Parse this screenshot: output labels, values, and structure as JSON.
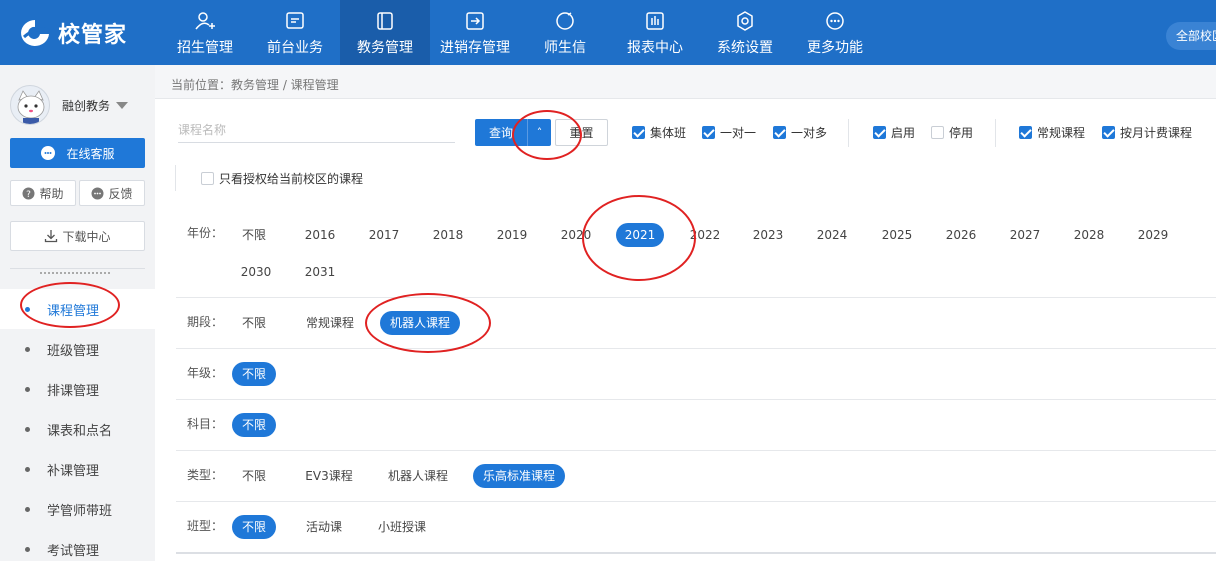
{
  "header": {
    "logo_text": "校管家",
    "nav": [
      {
        "label": "招生管理",
        "icon": "person-add-icon",
        "active": false
      },
      {
        "label": "前台业务",
        "icon": "monitor-icon",
        "active": false
      },
      {
        "label": "教务管理",
        "icon": "book-icon",
        "active": true
      },
      {
        "label": "进销存管理",
        "icon": "inventory-icon",
        "active": false
      },
      {
        "label": "师生信",
        "icon": "chat-icon",
        "active": false
      },
      {
        "label": "报表中心",
        "icon": "chart-icon",
        "active": false
      },
      {
        "label": "系统设置",
        "icon": "gear-icon",
        "active": false
      },
      {
        "label": "更多功能",
        "icon": "more-icon",
        "active": false
      }
    ],
    "campus_label": "全部校区",
    "colors": {
      "primary": "#1f6fc7",
      "active_nav": "#1a5daa",
      "accent": "#1f78d8",
      "annotation": "#e02222"
    }
  },
  "sidebar": {
    "username": "融创教务",
    "online_service": "在线客服",
    "help": "帮助",
    "feedback": "反馈",
    "download": "下载中心",
    "menu": [
      {
        "label": "课程管理",
        "active": true
      },
      {
        "label": "班级管理",
        "active": false
      },
      {
        "label": "排课管理",
        "active": false
      },
      {
        "label": "课表和点名",
        "active": false
      },
      {
        "label": "补课管理",
        "active": false
      },
      {
        "label": "学管师带班",
        "active": false
      },
      {
        "label": "考试管理",
        "active": false
      }
    ]
  },
  "main": {
    "breadcrumb": "当前位置：教务管理 / 课程管理",
    "search_placeholder": "课程名称",
    "query_button": "查询",
    "reset_button": "重置",
    "checkboxes": [
      {
        "label": "集体班",
        "checked": true
      },
      {
        "label": "一对一",
        "checked": true
      },
      {
        "label": "一对多",
        "checked": true
      },
      {
        "label": "启用",
        "checked": true
      },
      {
        "label": "停用",
        "checked": false
      },
      {
        "label": "常规课程",
        "checked": true
      },
      {
        "label": "按月计费课程",
        "checked": true
      }
    ],
    "only_authorized": "只看授权给当前校区的课程",
    "filters": {
      "year": {
        "label": "年份：",
        "options": [
          "不限",
          "2016",
          "2017",
          "2018",
          "2019",
          "2020",
          "2021",
          "2022",
          "2023",
          "2024",
          "2025",
          "2026",
          "2027",
          "2028",
          "2029",
          "2030",
          "2031"
        ],
        "selected": "2021"
      },
      "term": {
        "label": "期段：",
        "options": [
          "不限",
          "常规课程",
          "机器人课程"
        ],
        "selected": "机器人课程"
      },
      "grade": {
        "label": "年级：",
        "options": [
          "不限"
        ],
        "selected": "不限"
      },
      "subject": {
        "label": "科目：",
        "options": [
          "不限"
        ],
        "selected": "不限"
      },
      "type": {
        "label": "类型：",
        "options": [
          "不限",
          "EV3课程",
          "机器人课程",
          "乐高标准课程"
        ],
        "selected": "乐高标准课程"
      },
      "class_type": {
        "label": "班型：",
        "options": [
          "不限",
          "活动课",
          "小班授课"
        ],
        "selected": "不限"
      }
    }
  }
}
